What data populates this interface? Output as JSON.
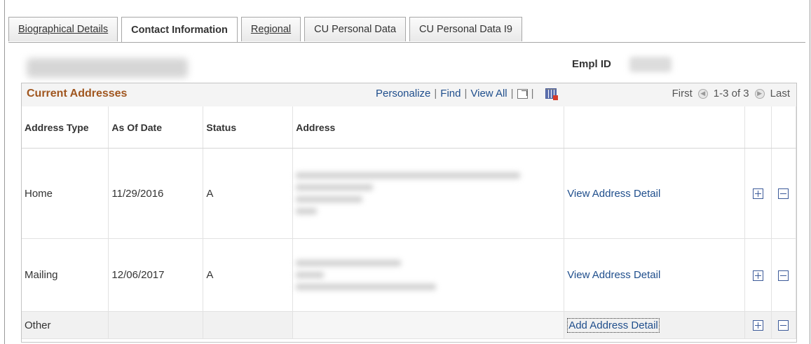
{
  "tabs": [
    {
      "label": "Biographical Details",
      "active": false
    },
    {
      "label": "Contact Information",
      "active": true
    },
    {
      "label": "Regional",
      "active": false
    },
    {
      "label": "CU Personal Data",
      "active": false
    },
    {
      "label": "CU Personal Data I9",
      "active": false
    }
  ],
  "header": {
    "empl_id_label": "Empl ID"
  },
  "grid": {
    "title": "Current Addresses",
    "personalize": "Personalize",
    "find": "Find",
    "view_all": "View All",
    "first": "First",
    "range": "1-3 of 3",
    "last": "Last",
    "columns": [
      "Address Type",
      "As Of Date",
      "Status",
      "Address"
    ],
    "rows": [
      {
        "type": "Home",
        "date": "11/29/2016",
        "status": "A",
        "action": "View Address Detail"
      },
      {
        "type": "Mailing",
        "date": "12/06/2017",
        "status": "A",
        "action": "View Address Detail"
      },
      {
        "type": "Other",
        "date": "",
        "status": "",
        "action": "Add Address Detail"
      }
    ]
  },
  "icons": {
    "new_window": "new-window-icon",
    "download": "download-grid-icon",
    "prev": "previous-icon",
    "next": "next-icon",
    "add_row": "plus-icon",
    "delete_row": "minus-icon"
  },
  "colors": {
    "title": "#a0561f",
    "link": "#1f4e8c",
    "button_border": "#3c5a99"
  }
}
